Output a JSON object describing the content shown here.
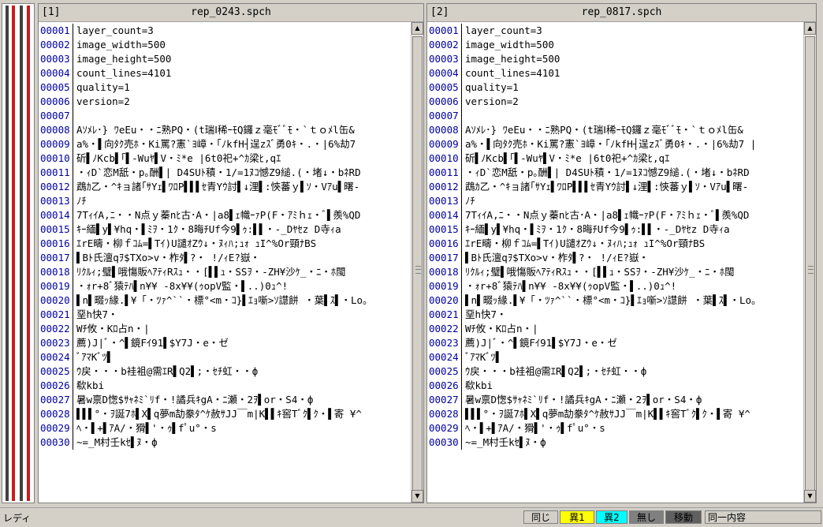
{
  "colors": {
    "diff_strip_dark": "#404040",
    "diff_strip_red": "#cc1a1a",
    "same": "#d4d0c8",
    "diff1": "#ffff00",
    "diff2": "#00ffff",
    "none": "#808080",
    "move": "#606060"
  },
  "left": {
    "index": "[1]",
    "title": "rep_0243.spch",
    "lines": [
      {
        "n": "00001",
        "t": "layer_count=3"
      },
      {
        "n": "00002",
        "t": "image_width=500"
      },
      {
        "n": "00003",
        "t": "image_height=500"
      },
      {
        "n": "00004",
        "t": "count_lines=4101"
      },
      {
        "n": "00005",
        "t": "quality=1"
      },
      {
        "n": "00006",
        "t": "version=2"
      },
      {
        "n": "00007",
        "t": ""
      },
      {
        "n": "00008",
        "t": "Aｿﾒﾚ･} ﾜeEu・・ﾆ熟PQ・(t瑞Ⅰ稀ｰﾓQ鑼ｚ毫ﾓﾞﾞﾓ・`ｔｏﾒl缶&"
      },
      {
        "n": "00009",
        "t": "a%・▌向ﾀｸ売ﾎ・Ki罵?憲`ﾖ嶂・｢ﾉkfH┤逞zｽﾞ勇0ｷ・.・|6%劫7"
      },
      {
        "n": "00010",
        "t": "斫▌ﾉKcb▌｢▌-Wuﾔ▌V・ﾐ*e |6t0祀+^ｶ梁ﾋ,qｴ"
      },
      {
        "n": "00011",
        "t": "・ｨD`恋M舐・p｡酬▌| D4SUﾄ積・1/=1ﾇｺ憾Z9縋.(・堵↓・bﾈRD"
      },
      {
        "n": "00012",
        "t": "鵡ｶ乙・^ｷョ諸｢ｻYｪ▌ﾜﾛP▌▌▌ｾ青Yｳ討▌↓浬▌:悏蕃ｙ▌ｿ・Vｱu▌曙-"
      },
      {
        "n": "00013",
        "t": "ﾉﾁ"
      },
      {
        "n": "00014",
        "t": "7TｨｲA,ﾆ・・N点ｙ蓁nﾋ古･A・|a8▌ｪ幟ｰｧP(F・ｱﾐｈｪ・ﾞ▌羨%QD"
      },
      {
        "n": "00015",
        "t": "ｷｰ緬▌y▌¥hq・▌ﾐｦ・1ｸ・8晦ﾁUf今9▌ｩ:▌▌・-_Dﾔｾz     D寺ｨa"
      },
      {
        "n": "00016",
        "t": "ｴrE疇・柳ｆｺﾑ=▌Tｲ)U譴ｵZｳ↓・ﾇｨﾊ;ｭｫ ｭI^%Or頸ﾅBS"
      },
      {
        "n": "00017",
        "t": "▌Bﾄ氏澶qｦ$TXo>v・柞ﾀ▌?・ !/ｨE?嶽・"
      },
      {
        "n": "00018",
        "t": "ﾘｸﾙｨ;璧▌哦慯販ﾍｱﾃｨRｽｭ・・[▌▌ｭ・SSｦ・-ZH¥沙ｹ_・ﾆ・ﾎ閩"
      },
      {
        "n": "00019",
        "t": "・ｫr+8ﾞ猿ﾃﾊ▌n¥¥ -8x¥¥(ｩopV監・▌..)0ｭ^!"
      },
      {
        "n": "00020",
        "t": "▌n▌畷ｯ緣.▌¥「・ﾂｧ^``・標°<m・ｺ}▌ｴｮ噺>ｿ譿餅 ・葉▌ｽ▌・Lo。"
      },
      {
        "n": "00021",
        "t": "堊h快7・"
      },
      {
        "n": "00022",
        "t": "Wﾁ攸・Kﾛ占n・|"
      },
      {
        "n": "00023",
        "t": "薦)J|ﾞ・^▌鏡Fｲ91▌$Y7J・e・ゼ"
      },
      {
        "n": "00024",
        "t": "ﾞｱﾏKﾞﾂ▌"
      },
      {
        "n": "00025",
        "t": "ｳ戻・・・b袿袓@需ｴR▌Q2▌;・ｾﾁ虹・・ф"
      },
      {
        "n": "00026",
        "t": "欷kbi"
      },
      {
        "n": "00027",
        "t": "暑w禀D愡$ｻｬﾈﾐ`ﾘf・!譎兵ｷgA・ﾆ瀬・2ｦ▌or・S4・ф"
      },
      {
        "n": "00028",
        "t": "▌▌▌°・ｦ誕7ﾎ▌X▌q夢m劼豢ﾀ^ｹ赦ｻJJ￣m|K▌▌ｷ窖Tﾞｸ▌ｸ・▌寄 ¥^"
      },
      {
        "n": "00029",
        "t": "ﾍ・▌+▌ｱA/・猾▌'・ｩ▌fﾟu°・s"
      },
      {
        "n": "00030",
        "t": "~=_M村壬kｾ▌ﾇ・ф"
      }
    ]
  },
  "right": {
    "index": "[2]",
    "title": "rep_0817.spch",
    "lines": [
      {
        "n": "00001",
        "t": "layer_count=3"
      },
      {
        "n": "00002",
        "t": "image_width=500"
      },
      {
        "n": "00003",
        "t": "image_height=500"
      },
      {
        "n": "00004",
        "t": "count_lines=4101"
      },
      {
        "n": "00005",
        "t": "quality=1"
      },
      {
        "n": "00006",
        "t": "version=2"
      },
      {
        "n": "00007",
        "t": ""
      },
      {
        "n": "00008",
        "t": "Aｿﾒﾚ･} ﾜeEu・・ﾆ熟PQ・(t瑞Ⅰ稀ｰﾓQ鑼ｚ毫ﾓﾞﾞﾓ・`ｔｏﾒl缶&"
      },
      {
        "n": "00009",
        "t": "a%・▌向ﾀｸ売ﾎ・Ki罵?憲`ﾖ嶂・｢ﾉkfH┤逞zｽﾞ勇0ｷ・.・|6%劫7 |"
      },
      {
        "n": "00010",
        "t": "斫▌ﾉKcb▌｢▌-Wuﾔ▌V・ﾐ*e |6t0祀+^ｶ梁ﾋ,qｴ"
      },
      {
        "n": "00011",
        "t": "・ｨD`恋M舐・p｡酬▌| D4SUﾄ積・1/=1ﾇｺ憾Z9縋.(・堵↓・bﾈRD"
      },
      {
        "n": "00012",
        "t": "鵡ｶ乙・^ｷョ諸｢ｻYｪ▌ﾜﾛP▌▌▌ｾ青Yｳ討▌↓浬▌:悏蕃ｙ▌ｿ・Vｱu▌曙-"
      },
      {
        "n": "00013",
        "t": "ﾉﾁ"
      },
      {
        "n": "00014",
        "t": "7TｨｲA,ﾆ・・N点ｙ蓁nﾋ古･A・|a8▌ｪ幟ｰｧP(F・ｱﾐｈｪ・ﾞ▌羨%QD"
      },
      {
        "n": "00015",
        "t": "ｷｰ緬▌y▌¥hq・▌ﾐｦ・1ｸ・8晦ﾁUf今9▌ｩ:▌▌・-_Dﾔｾz     D寺ｨa"
      },
      {
        "n": "00016",
        "t": "ｴrE疇・柳ｆｺﾑ=▌Tｲ)U譴ｵZｳ↓・ﾇｨﾊ;ｭｫ ｭI^%Or頸ﾅBS"
      },
      {
        "n": "00017",
        "t": "▌Bﾄ氏澶qｦ$TXo>v・柞ﾀ▌?・ !/ｨE?嶽・"
      },
      {
        "n": "00018",
        "t": "ﾘｸﾙｨ;璧▌哦慯販ﾍｱﾃｨRｽｭ・・[▌▌ｭ・SSｦ・-ZH¥沙ｹ_・ﾆ・ﾎ閩"
      },
      {
        "n": "00019",
        "t": "・ｫr+8ﾞ猿ﾃﾊ▌n¥¥ -8x¥¥(ｩopV監・▌..)0ｭ^!"
      },
      {
        "n": "00020",
        "t": "▌n▌畷ｯ緣.▌¥「・ﾂｧ^``・標°<m・ｺ}▌ｴｮ噺>ｿ譿餅 ・葉▌ｽ▌・Lo。"
      },
      {
        "n": "00021",
        "t": "堊h快7・"
      },
      {
        "n": "00022",
        "t": "Wﾁ攸・Kﾛ占n・|"
      },
      {
        "n": "00023",
        "t": "薦)J|ﾞ・^▌鏡Fｲ91▌$Y7J・e・ゼ"
      },
      {
        "n": "00024",
        "t": "ﾞｱﾏKﾞﾂ▌"
      },
      {
        "n": "00025",
        "t": "ｳ戻・・・b袿袓@需ｴR▌Q2▌;・ｾﾁ虹・・ф"
      },
      {
        "n": "00026",
        "t": "欷kbi"
      },
      {
        "n": "00027",
        "t": "暑w禀D愡$ｻｬﾈﾐ`ﾘf・!譎兵ｷgA・ﾆ瀬・2ｦ▌or・S4・ф"
      },
      {
        "n": "00028",
        "t": "▌▌▌°・ｦ誕7ﾎ▌X▌q夢m劼豢ﾀ^ｹ赦ｻJJ￣m|K▌▌ｷ窖Tﾞｸ▌ｸ・▌寄 ¥^"
      },
      {
        "n": "00029",
        "t": "ﾍ・▌+▌ｱA/・猾▌'・ｩ▌fﾟu°・s"
      },
      {
        "n": "00030",
        "t": "~=_M村壬kｾ▌ﾇ・ф"
      }
    ]
  },
  "status": {
    "text": "レディ",
    "same": "同じ",
    "diff1": "異1",
    "diff2": "異2",
    "none": "無し",
    "move": "移動",
    "right": "同一内容"
  }
}
